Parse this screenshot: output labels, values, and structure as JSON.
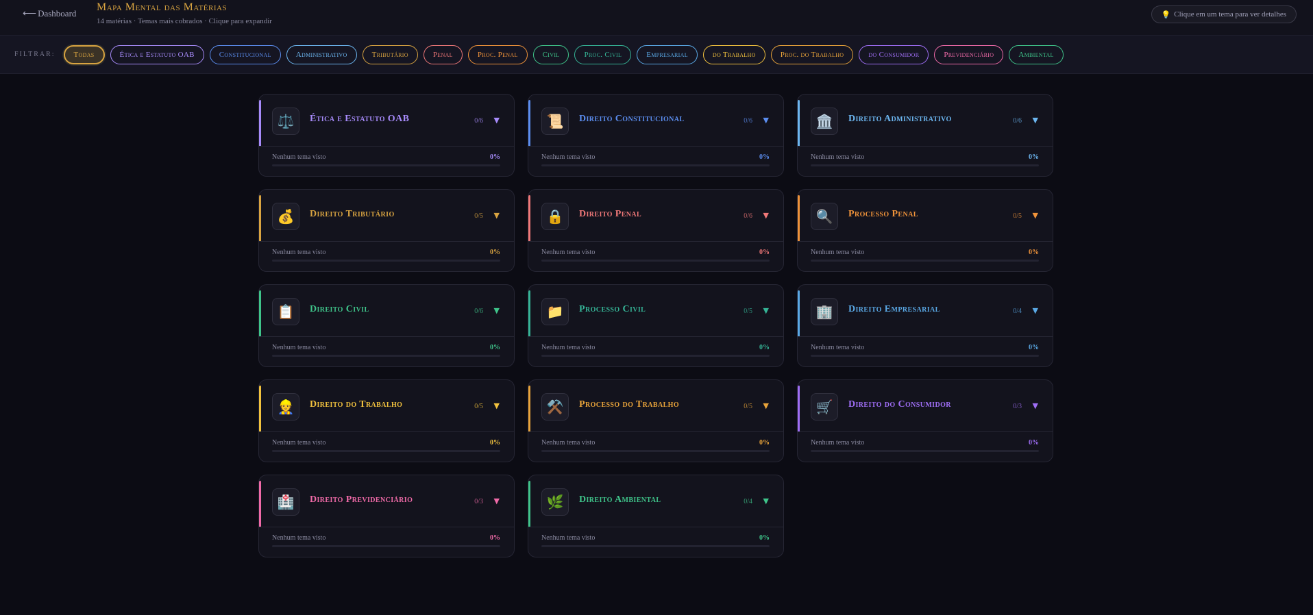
{
  "header": {
    "back_label": "Dashboard",
    "title": "Mapa Mental das Matérias",
    "subtitle": "14 matérias · Temas mais cobrados · Clique para expandir",
    "hint": "Clique em um tema para ver detalhes"
  },
  "filter": {
    "label": "FILTRAR:",
    "chips": [
      {
        "label": "Todas",
        "color": "#d9a441",
        "active": true
      },
      {
        "label": "Ética e Estatuto OAB",
        "color": "#a78bfa"
      },
      {
        "label": "Constitucional",
        "color": "#5b8def"
      },
      {
        "label": "Administrativo",
        "color": "#6cb6f0"
      },
      {
        "label": "Tributário",
        "color": "#d9a441"
      },
      {
        "label": "Penal",
        "color": "#f07878"
      },
      {
        "label": "Proc. Penal",
        "color": "#f0933a"
      },
      {
        "label": "Civil",
        "color": "#3fc48a"
      },
      {
        "label": "Proc. Civil",
        "color": "#35b496"
      },
      {
        "label": "Empresarial",
        "color": "#5aa9e6"
      },
      {
        "label": "do Trabalho",
        "color": "#f2c23e"
      },
      {
        "label": "Proc. do Trabalho",
        "color": "#e8a33a"
      },
      {
        "label": "do Consumidor",
        "color": "#9f6ef5"
      },
      {
        "label": "Previdenciário",
        "color": "#f06aa8"
      },
      {
        "label": "Ambiental",
        "color": "#3fc48a"
      }
    ]
  },
  "cards": [
    {
      "title": "Ética e Estatuto OAB",
      "icon": "⚖️",
      "icon_name": "scales-icon",
      "count": "0/6",
      "status": "Nenhum tema visto",
      "pct": "0%",
      "progress": 0,
      "color": "#a78bfa"
    },
    {
      "title": "Direito Constitucional",
      "icon": "📜",
      "icon_name": "scroll-icon",
      "count": "0/6",
      "status": "Nenhum tema visto",
      "pct": "0%",
      "progress": 0,
      "color": "#5b8def"
    },
    {
      "title": "Direito Administrativo",
      "icon": "🏛️",
      "icon_name": "building-columns-icon",
      "count": "0/6",
      "status": "Nenhum tema visto",
      "pct": "0%",
      "progress": 0,
      "color": "#6cb6f0"
    },
    {
      "title": "Direito Tributário",
      "icon": "💰",
      "icon_name": "money-bag-icon",
      "count": "0/5",
      "status": "Nenhum tema visto",
      "pct": "0%",
      "progress": 0,
      "color": "#d9a441"
    },
    {
      "title": "Direito Penal",
      "icon": "🔒",
      "icon_name": "lock-icon",
      "count": "0/6",
      "status": "Nenhum tema visto",
      "pct": "0%",
      "progress": 0,
      "color": "#f07878"
    },
    {
      "title": "Processo Penal",
      "icon": "🔍",
      "icon_name": "magnifier-icon",
      "count": "0/5",
      "status": "Nenhum tema visto",
      "pct": "0%",
      "progress": 0,
      "color": "#f0933a"
    },
    {
      "title": "Direito Civil",
      "icon": "📋",
      "icon_name": "clipboard-icon",
      "count": "0/6",
      "status": "Nenhum tema visto",
      "pct": "0%",
      "progress": 0,
      "color": "#3fc48a"
    },
    {
      "title": "Processo Civil",
      "icon": "📁",
      "icon_name": "folder-icon",
      "count": "0/5",
      "status": "Nenhum tema visto",
      "pct": "0%",
      "progress": 0,
      "color": "#35b496"
    },
    {
      "title": "Direito Empresarial",
      "icon": "🏢",
      "icon_name": "office-building-icon",
      "count": "0/4",
      "status": "Nenhum tema visto",
      "pct": "0%",
      "progress": 0,
      "color": "#5aa9e6"
    },
    {
      "title": "Direito do Trabalho",
      "icon": "👷",
      "icon_name": "worker-icon",
      "count": "0/5",
      "status": "Nenhum tema visto",
      "pct": "0%",
      "progress": 0,
      "color": "#f2c23e"
    },
    {
      "title": "Processo do Trabalho",
      "icon": "⚒️",
      "icon_name": "hammer-pick-icon",
      "count": "0/5",
      "status": "Nenhum tema visto",
      "pct": "0%",
      "progress": 0,
      "color": "#e8a33a"
    },
    {
      "title": "Direito do Consumidor",
      "icon": "🛒",
      "icon_name": "shopping-cart-icon",
      "count": "0/3",
      "status": "Nenhum tema visto",
      "pct": "0%",
      "progress": 0,
      "color": "#9f6ef5"
    },
    {
      "title": "Direito Previdenciário",
      "icon": "🏥",
      "icon_name": "hospital-icon",
      "count": "0/3",
      "status": "Nenhum tema visto",
      "pct": "0%",
      "progress": 0,
      "color": "#f06aa8"
    },
    {
      "title": "Direito Ambiental",
      "icon": "🌿",
      "icon_name": "leaf-icon",
      "count": "0/4",
      "status": "Nenhum tema visto",
      "pct": "0%",
      "progress": 0,
      "color": "#3fc48a"
    }
  ]
}
